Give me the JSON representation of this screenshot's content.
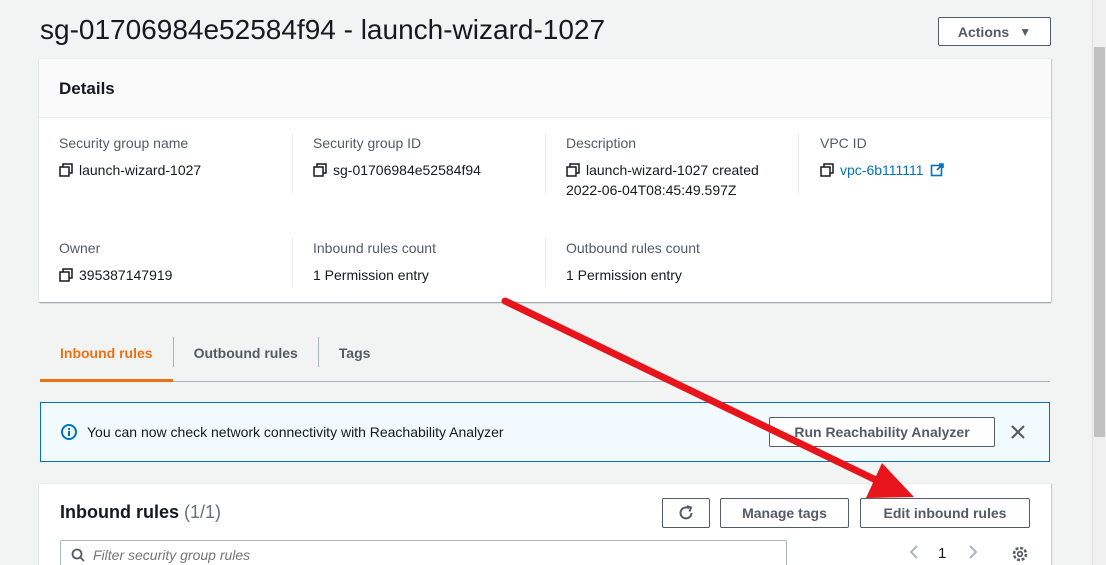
{
  "page": {
    "title": "sg-01706984e52584f94 - launch-wizard-1027",
    "actions_label": "Actions"
  },
  "details": {
    "header": "Details",
    "fields": [
      {
        "label": "Security group name",
        "value": "launch-wizard-1027"
      },
      {
        "label": "Security group ID",
        "value": "sg-01706984e52584f94"
      },
      {
        "label": "Description",
        "value_line1": "launch-wizard-1027 created",
        "value_line2": "2022-06-04T08:45:49.597Z"
      },
      {
        "label": "VPC ID",
        "value": "vpc-6b111111"
      },
      {
        "label": "Owner",
        "value": "395387147919"
      },
      {
        "label": "Inbound rules count",
        "value": "1 Permission entry"
      },
      {
        "label": "Outbound rules count",
        "value": "1 Permission entry"
      }
    ]
  },
  "tabs": [
    {
      "label": "Inbound rules",
      "active": true
    },
    {
      "label": "Outbound rules",
      "active": false
    },
    {
      "label": "Tags",
      "active": false
    }
  ],
  "flash": {
    "message": "You can now check network connectivity with Reachability Analyzer",
    "button_label": "Run Reachability Analyzer"
  },
  "rules": {
    "title": "Inbound rules",
    "count": "(1/1)",
    "manage_tags_label": "Manage tags",
    "edit_label": "Edit inbound rules",
    "filter_placeholder": "Filter security group rules",
    "current_page": "1"
  },
  "colors": {
    "accent_orange": "#ec7211",
    "link_blue": "#0073bb",
    "annotation_red": "#e8141b"
  },
  "icons": [
    "copy-icon",
    "external-link-icon",
    "info-icon",
    "close-icon",
    "refresh-icon",
    "search-icon",
    "chevron-left-icon",
    "chevron-right-icon",
    "gear-icon",
    "caret-down-icon"
  ]
}
